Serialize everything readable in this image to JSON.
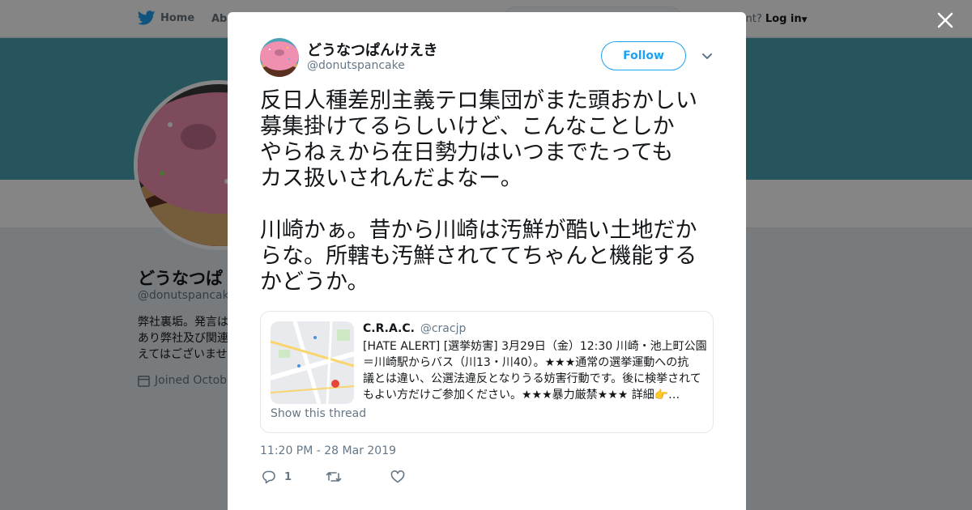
{
  "topbar": {
    "home_label": "Home",
    "about_label": "Abo",
    "account_text": "ccount?",
    "login_label": "Log in"
  },
  "profile": {
    "name": "どうなつぱ",
    "handle": "@donutspancake",
    "bio": "弊社裏垢。発言は\nあり弊社及び関連\nえてはございませ",
    "joined": "Joined Octobe"
  },
  "tweet": {
    "author_name": "どうなつぱんけえき",
    "author_handle": "@donutspancake",
    "follow_label": "Follow",
    "paragraph1": "反日人種差別主義テロ集団がまた頭おかしい\n募集掛けてるらしいけど、こんなことしか\nやらねぇから在日勢力はいつまでたっても\nカス扱いされんだよなー。",
    "paragraph2": "川崎かぁ。昔から川崎は汚鮮が酷い土地だか\nらな。所轄も汚鮮されててちゃんと機能する\nかどうか。",
    "timestamp": "11:20 PM - 28 Mar 2019",
    "reply_count": "1"
  },
  "quote": {
    "name": "C.R.A.C.",
    "handle": "@cracjp",
    "text": "[HATE ALERT] [選挙妨害] 3月29日（金）12:30 川崎・池上町公園\n＝川崎駅からバス（川13・川40）。★★★通常の選挙運動への抗\n議とは違い、公選法違反となりうる妨害行動です。後に検挙されて\nもよい方だけご参加ください。★★★暴力厳禁★★★ 詳細👉…",
    "show_thread_label": "Show this thread"
  },
  "colors": {
    "brand_blue": "#1da1f2",
    "banner": "#4aa3b5",
    "secondary_text": "#657786"
  },
  "icons": {
    "close": "close-icon",
    "bird": "twitter-bird-icon",
    "chevron": "chevron-down-icon",
    "reply": "reply-icon",
    "retweet": "retweet-icon",
    "like": "heart-icon",
    "calendar": "calendar-icon"
  }
}
